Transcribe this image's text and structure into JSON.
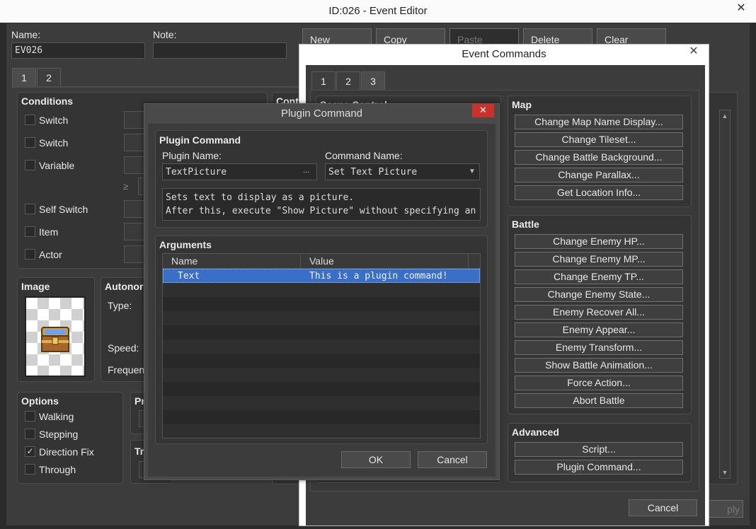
{
  "main_window": {
    "title": "ID:026 - Event Editor",
    "close_icon": "close-icon"
  },
  "event": {
    "name_label": "Name:",
    "name_value": "EV026",
    "note_label": "Note:",
    "note_value": "",
    "toolbar": {
      "new": "New",
      "copy": "Copy",
      "paste": "Paste",
      "delete": "Delete",
      "clear": "Clear"
    },
    "page_tabs": [
      "1",
      "2"
    ],
    "conditions": {
      "title": "Conditions",
      "items": [
        "Switch",
        "Switch",
        "Variable",
        "Self Switch",
        "Item",
        "Actor"
      ],
      "ge_symbol": "≥"
    },
    "contents_title_partial": "Cont",
    "image_title": "Image",
    "autonomous": {
      "title": "Autonor",
      "type_label": "Type:",
      "speed_label": "Speed:",
      "freq_label": "Frequenc"
    },
    "options": {
      "title": "Options",
      "items": [
        {
          "label": "Walking",
          "checked": false
        },
        {
          "label": "Stepping",
          "checked": false
        },
        {
          "label": "Direction Fix",
          "checked": true
        },
        {
          "label": "Through",
          "checked": false
        }
      ],
      "check_mark": "✓"
    },
    "priority_partial": "Pr",
    "trigger_partial": "Tr",
    "apply_partial": "ply"
  },
  "commands_window": {
    "title": "Event Commands",
    "tabs": [
      "1",
      "2",
      "3"
    ],
    "active_tab": "3",
    "scene_control_partial": "Scene Control",
    "map": {
      "title": "Map",
      "buttons": [
        "Change Map Name Display...",
        "Change Tileset...",
        "Change Battle Background...",
        "Change Parallax...",
        "Get Location Info..."
      ]
    },
    "battle": {
      "title": "Battle",
      "buttons": [
        "Change Enemy HP...",
        "Change Enemy MP...",
        "Change Enemy TP...",
        "Change Enemy State...",
        "Enemy Recover All...",
        "Enemy Appear...",
        "Enemy Transform...",
        "Show Battle Animation...",
        "Force Action...",
        "Abort Battle"
      ]
    },
    "advanced": {
      "title": "Advanced",
      "buttons": [
        "Script...",
        "Plugin Command..."
      ]
    },
    "cancel": "Cancel"
  },
  "plugin_dialog": {
    "title": "Plugin Command",
    "group_title": "Plugin Command",
    "plugin_name_label": "Plugin Name:",
    "plugin_name_value": "TextPicture",
    "ellipsis": "...",
    "command_name_label": "Command Name:",
    "command_name_value": "Set Text Picture",
    "dropdown_icon": "▼",
    "description": [
      "Sets text to display as a picture.",
      "After this, execute \"Show Picture\" without specifying an image."
    ],
    "arguments_title": "Arguments",
    "columns": [
      "Name",
      "Value"
    ],
    "rows": [
      {
        "name": "Text",
        "value": "This is a plugin command!"
      }
    ],
    "ok": "OK",
    "cancel": "Cancel"
  },
  "colors": {
    "accent_selection": "#3a6fc8",
    "close_red": "#c9312a"
  }
}
